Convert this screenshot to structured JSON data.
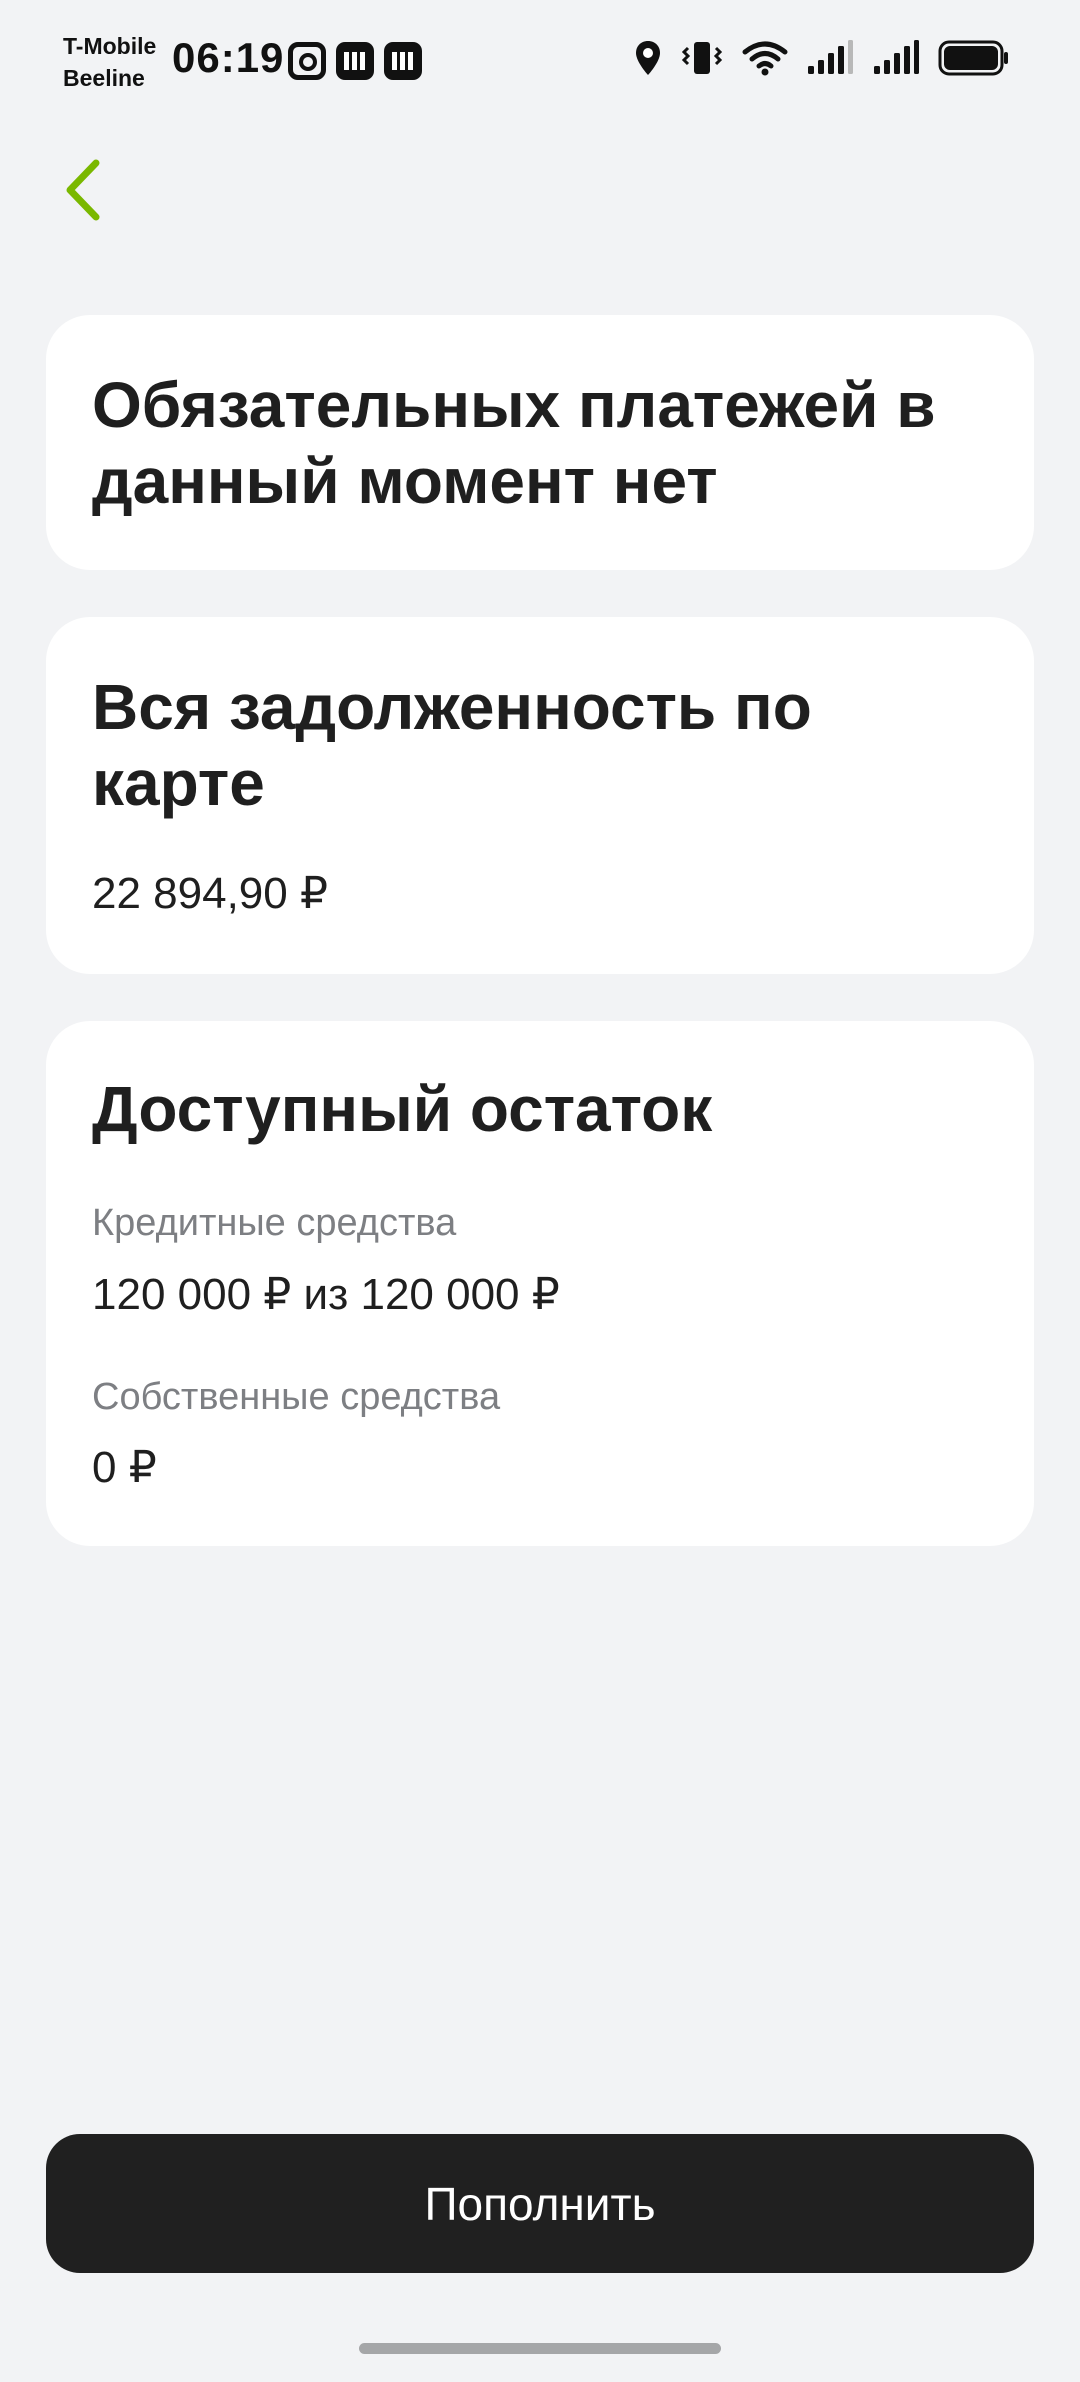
{
  "status_bar": {
    "carrier_1": "T-Mobile",
    "carrier_2": "Beeline",
    "time": "06:19",
    "notification_icons": [
      "instagram-icon",
      "bank-app-icon",
      "bank-app-icon"
    ],
    "system_icons": [
      "location-icon",
      "vibrate-icon",
      "wifi-icon",
      "signal-icon",
      "signal-icon",
      "battery-icon"
    ]
  },
  "header": {
    "back_icon": "chevron-left-icon",
    "accent_color": "#7ab800"
  },
  "mandatory_payments": {
    "title": "Обязательных платежей в данный момент нет"
  },
  "total_debt": {
    "title": "Вся задолженность по карте",
    "amount": "22 894,90 ₽"
  },
  "available_balance": {
    "title": "Доступный остаток",
    "credit_label": "Кредитные средства",
    "credit_value": "120 000 ₽ из 120 000 ₽",
    "own_label": "Собственные средства",
    "own_value": "0 ₽"
  },
  "actions": {
    "topup_label": "Пополнить"
  }
}
